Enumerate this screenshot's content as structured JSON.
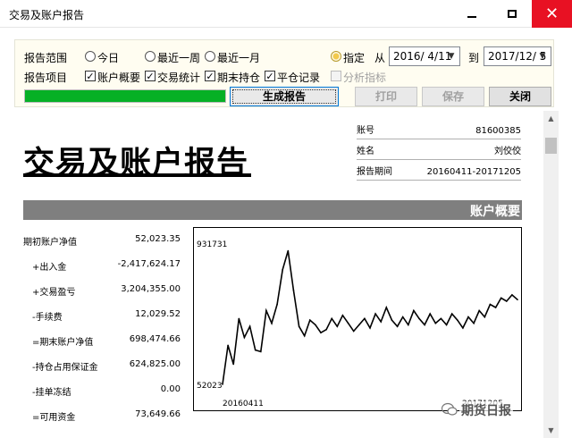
{
  "window": {
    "title": "交易及账户报告"
  },
  "controls": {
    "range_label": "报告范围",
    "range_options": [
      "今日",
      "最近一周",
      "最近一月",
      "指定"
    ],
    "range_selected": "指定",
    "from_label": "从",
    "from_date": "2016/ 4/11",
    "to_label": "到",
    "to_date": "2017/12/ 5",
    "items_label": "报告项目",
    "items": [
      {
        "label": "账户概要",
        "checked": true,
        "enabled": true
      },
      {
        "label": "交易统计",
        "checked": true,
        "enabled": true
      },
      {
        "label": "期末持仓",
        "checked": true,
        "enabled": true
      },
      {
        "label": "平仓记录",
        "checked": true,
        "enabled": true
      },
      {
        "label": "分析指标",
        "checked": false,
        "enabled": false
      }
    ],
    "progress_fraction": 1.0,
    "generate_label": "生成报告",
    "print_label": "打印",
    "save_label": "保存",
    "close_label": "关闭"
  },
  "report": {
    "title": "交易及账户报告",
    "info": [
      {
        "key": "账号",
        "value": "81600385"
      },
      {
        "key": "姓名",
        "value": "刘佼佼"
      },
      {
        "key": "报告期间",
        "value": "20160411-20171205"
      }
    ],
    "section_title": "账户概要",
    "account": [
      {
        "key": "期初账户净值",
        "value": "52,023.35"
      },
      {
        "key": "+出入金",
        "value": "-2,417,624.17"
      },
      {
        "key": "+交易盈亏",
        "value": "3,204,355.00"
      },
      {
        "key": "-手续费",
        "value": "12,029.52"
      },
      {
        "key": "=期末账户净值",
        "value": "698,474.66"
      },
      {
        "key": "-持仓占用保证金",
        "value": "624,825.00"
      },
      {
        "key": "-挂单冻结",
        "value": "0.00"
      },
      {
        "key": "=可用资金",
        "value": "73,649.66"
      }
    ]
  },
  "watermark": "期货日报",
  "chart_data": {
    "type": "line",
    "ylim": [
      52023,
      931731
    ],
    "y_ticks": [
      "931731",
      "52023"
    ],
    "x_ticks": [
      "20160411",
      "20171205"
    ],
    "series": [
      {
        "values": [
          52023,
          300000,
          180000,
          470000,
          350000,
          420000,
          270000,
          260000,
          520000,
          440000,
          560000,
          780000,
          900000,
          650000,
          420000,
          360000,
          460000,
          430000,
          380000,
          400000,
          470000,
          420000,
          490000,
          440000,
          390000,
          430000,
          470000,
          410000,
          500000,
          450000,
          540000,
          460000,
          420000,
          480000,
          430000,
          520000,
          470000,
          430000,
          500000,
          440000,
          470000,
          430000,
          500000,
          460000,
          410000,
          480000,
          440000,
          520000,
          480000,
          560000,
          540000,
          600000,
          580000,
          620000,
          590000
        ]
      }
    ]
  }
}
